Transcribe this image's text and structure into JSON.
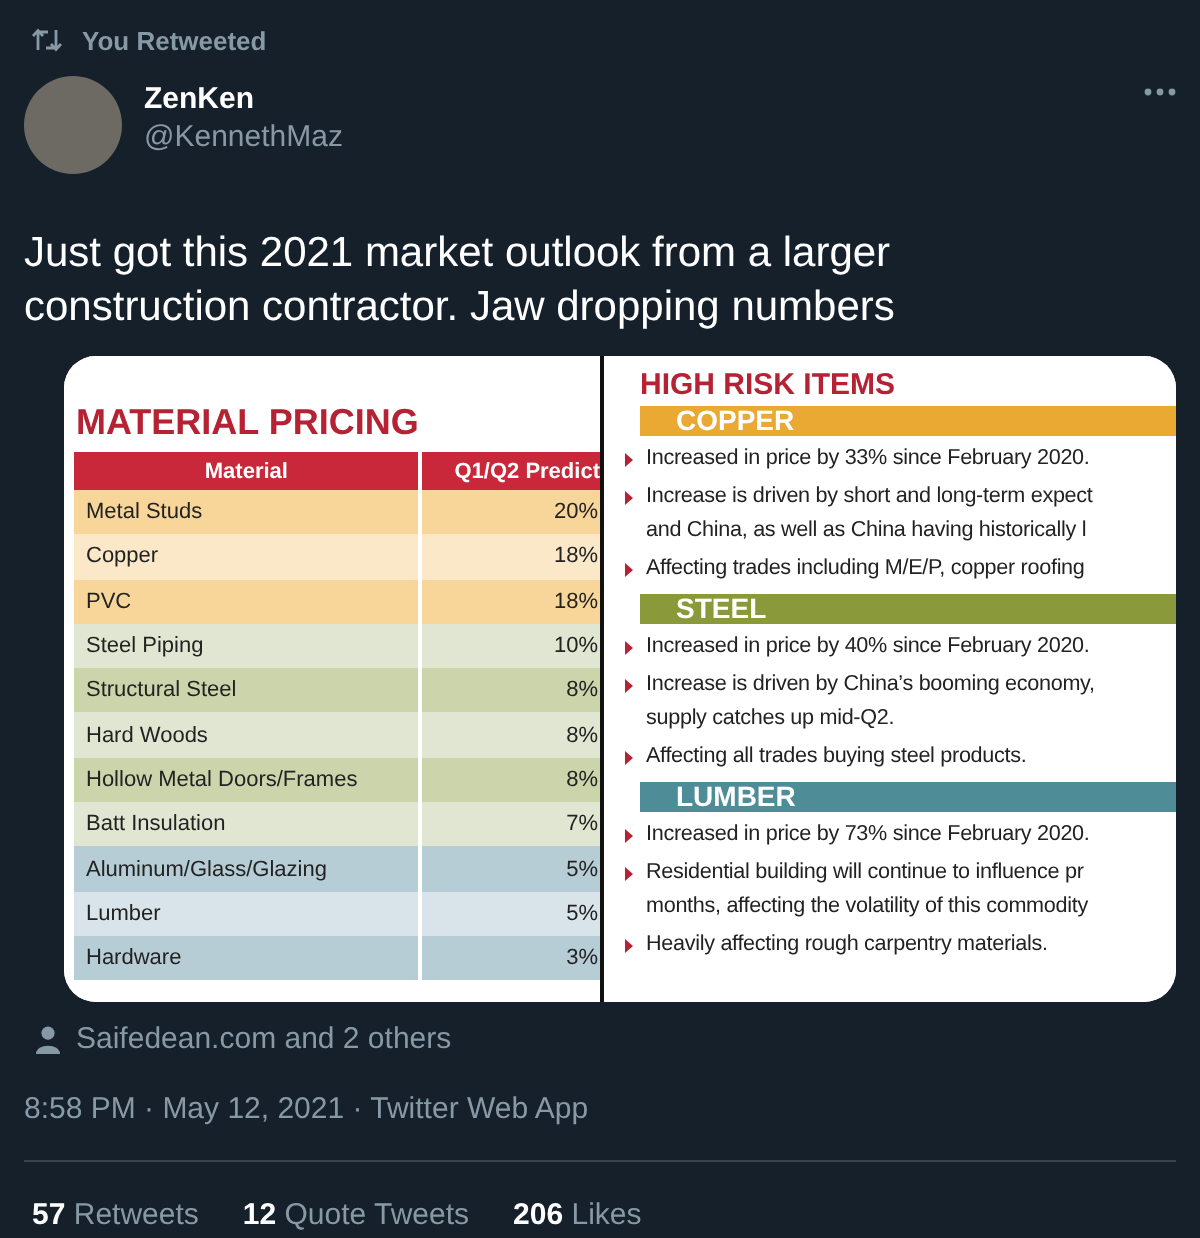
{
  "retweet_label": "You Retweeted",
  "author": {
    "name": "ZenKen",
    "handle": "@KennethMaz"
  },
  "text": "Just got this 2021 market outlook from a larger construction contractor. Jaw dropping numbers",
  "attachment": {
    "pricing": {
      "title": "MATERIAL PRICING",
      "columns": [
        "Material",
        "Q1/Q2 Predict"
      ],
      "rows": [
        {
          "material": "Metal Studs",
          "prediction": "20%",
          "color": "#f8d699"
        },
        {
          "material": "Copper",
          "prediction": "18%",
          "color": "#fbe8c8"
        },
        {
          "material": "PVC",
          "prediction": "18%",
          "color": "#f8d699"
        },
        {
          "material": "Steel Piping",
          "prediction": "10%",
          "color": "#e0e6d1"
        },
        {
          "material": "Structural Steel",
          "prediction": "8%",
          "color": "#cbd4ab"
        },
        {
          "material": "Hard Woods",
          "prediction": "8%",
          "color": "#e0e6d1"
        },
        {
          "material": "Hollow Metal Doors/Frames",
          "prediction": "8%",
          "color": "#cbd4ab"
        },
        {
          "material": "Batt Insulation",
          "prediction": "7%",
          "color": "#e0e6d1"
        },
        {
          "material": "Aluminum/Glass/Glazing",
          "prediction": "5%",
          "color": "#b6cdd6"
        },
        {
          "material": "Lumber",
          "prediction": "5%",
          "color": "#d8e4e9"
        },
        {
          "material": "Hardware",
          "prediction": "3%",
          "color": "#b6cdd6"
        }
      ]
    },
    "risk": {
      "title": "HIGH RISK ITEMS",
      "sections": [
        {
          "name": "COPPER",
          "color": "#e9a933",
          "bullets": [
            {
              "lines": [
                "Increased in price by 33% since February 2020."
              ]
            },
            {
              "lines": [
                "Increase is driven by short and long-term expect",
                "and China, as well as China having historically l"
              ]
            },
            {
              "lines": [
                "Affecting trades including M/E/P, copper roofing"
              ]
            }
          ]
        },
        {
          "name": "STEEL",
          "color": "#8a9a3a",
          "bullets": [
            {
              "lines": [
                "Increased in price by 40% since February 2020."
              ]
            },
            {
              "lines": [
                "Increase is driven by China’s booming economy,",
                "supply catches up mid-Q2."
              ]
            },
            {
              "lines": [
                "Affecting all trades buying steel products."
              ]
            }
          ]
        },
        {
          "name": "LUMBER",
          "color": "#4e8c98",
          "bullets": [
            {
              "lines": [
                "Increased in price by 73% since February 2020."
              ]
            },
            {
              "lines": [
                "Residential building will continue to influence pr",
                "months, affecting the volatility of this commodity"
              ]
            },
            {
              "lines": [
                "Heavily affecting rough carpentry materials."
              ]
            }
          ]
        }
      ]
    }
  },
  "social_context": "Saifedean.com and 2 others",
  "timestamp": "8:58 PM · May 12, 2021 · Twitter Web App",
  "stats": [
    {
      "count": "57",
      "label": "Retweets"
    },
    {
      "count": "12",
      "label": "Quote Tweets"
    },
    {
      "count": "206",
      "label": "Likes"
    }
  ]
}
